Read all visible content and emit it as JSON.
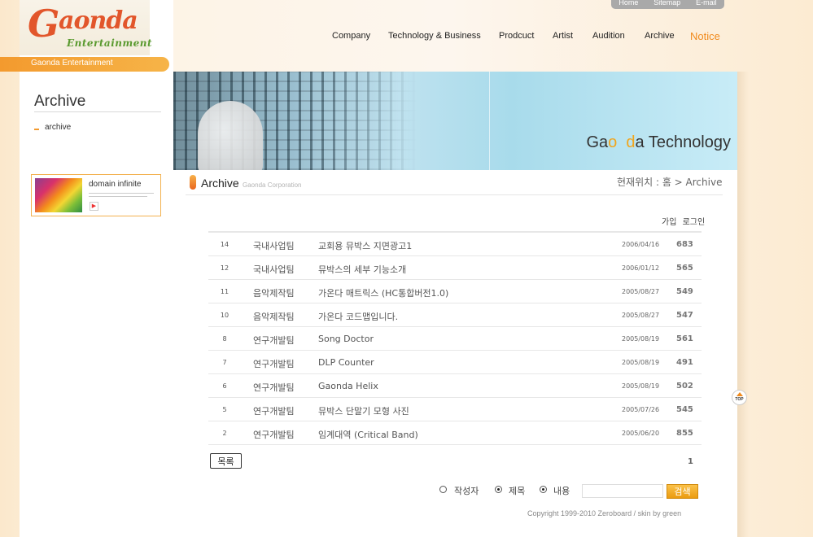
{
  "logo": {
    "g": "G",
    "rest": "aonda",
    "sub": "Entertainment",
    "bar_text": "Gaonda Entertainment"
  },
  "util_nav": [
    "Home",
    "Sitemap",
    "E-mail"
  ],
  "main_nav": [
    {
      "label": "Company"
    },
    {
      "label": "Technology & Business"
    },
    {
      "label": "Prodcuct"
    },
    {
      "label": "Artist"
    },
    {
      "label": "Audition"
    },
    {
      "label": "Archive"
    },
    {
      "label": "Notice",
      "active": true
    }
  ],
  "sidebar": {
    "title": "Archive",
    "item": "archive"
  },
  "ad": {
    "title": "domain infinite"
  },
  "hero": {
    "title_a": "Ga",
    "title_o1": "o",
    "title_gap": "  ",
    "title_o2": "d",
    "title_rest": "a Technology"
  },
  "section": {
    "title": "Archive",
    "subtitle": "Gaonda Corporation",
    "breadcrumb": "현재위치 : 홈 > Archive"
  },
  "top_links": [
    "가입",
    "로그인"
  ],
  "board": {
    "rows": [
      {
        "num": "14",
        "team": "국내사업팀",
        "title": "교회용 뮤박스 지면광고1",
        "date": "2006/04/16",
        "hits": "683"
      },
      {
        "num": "12",
        "team": "국내사업팀",
        "title": "뮤박스의 세부 기능소개",
        "date": "2006/01/12",
        "hits": "565"
      },
      {
        "num": "11",
        "team": "음악제작팀",
        "title": "가온다 매트릭스 (HC통합버전1.0)",
        "date": "2005/08/27",
        "hits": "549"
      },
      {
        "num": "10",
        "team": "음악제작팀",
        "title": "가온다 코드맵입니다.",
        "date": "2005/08/27",
        "hits": "547"
      },
      {
        "num": "8",
        "team": "연구개발팀",
        "title": "Song Doctor",
        "date": "2005/08/19",
        "hits": "561"
      },
      {
        "num": "7",
        "team": "연구개발팀",
        "title": "DLP Counter",
        "date": "2005/08/19",
        "hits": "491"
      },
      {
        "num": "6",
        "team": "연구개발팀",
        "title": "Gaonda Helix",
        "date": "2005/08/19",
        "hits": "502"
      },
      {
        "num": "5",
        "team": "연구개발팀",
        "title": "뮤박스 단말기 모형 사진",
        "date": "2005/07/26",
        "hits": "545"
      },
      {
        "num": "2",
        "team": "연구개발팀",
        "title": "임계대역 (Critical Band)",
        "date": "2005/06/20",
        "hits": "855"
      }
    ]
  },
  "list_button": "목록",
  "page_number": "1",
  "search": {
    "options": [
      {
        "label": "작성자",
        "checked": false
      },
      {
        "label": "제목",
        "checked": true
      },
      {
        "label": "내용",
        "checked": true
      }
    ],
    "input_value": "",
    "button": "검색"
  },
  "copyright": "Copyright 1999-2010 Zeroboard / skin by green",
  "top_button": "TOP"
}
